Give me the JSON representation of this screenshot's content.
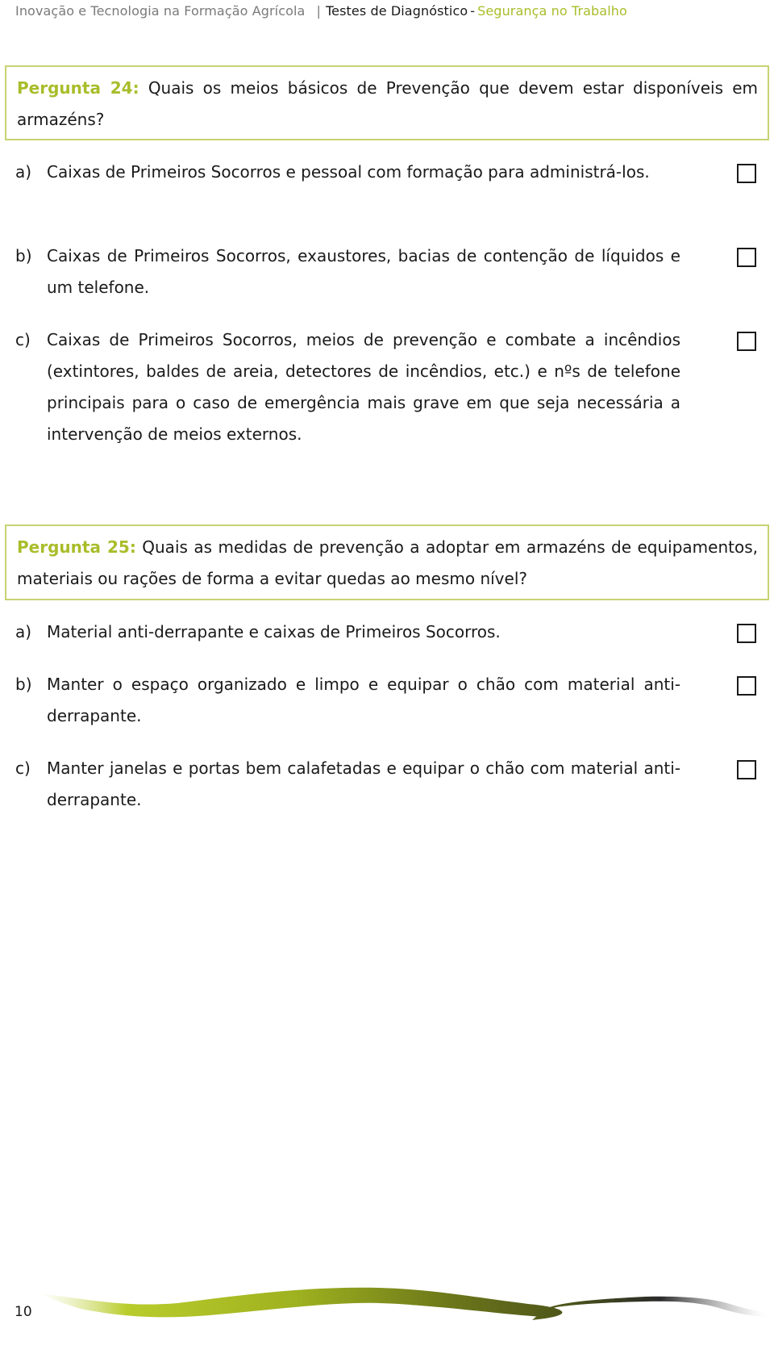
{
  "header": {
    "course": "Inovação e Tecnologia na Formação Agrícola",
    "separator": "|",
    "section": "Testes de Diagnóstico",
    "dash": "-",
    "topic": "Segurança no Trabalho"
  },
  "questions": [
    {
      "label": "Pergunta 24:",
      "text": "Quais os meios básicos de Prevenção que devem estar disponíveis em armazéns?",
      "options": [
        {
          "letter": "a)",
          "text": "Caixas de Primeiros Socorros e pessoal com formação para administrá-los.",
          "checked": false
        },
        {
          "letter": "b)",
          "text": "Caixas de Primeiros Socorros, exaustores, bacias de contenção de líquidos e um telefone.",
          "checked": false
        },
        {
          "letter": "c)",
          "text": "Caixas de Primeiros Socorros, meios de prevenção e combate a incêndios (extintores, baldes de areia, detectores de incêndios, etc.) e nºs de telefone principais para o caso de emergência mais grave em que seja necessária a intervenção de meios externos.",
          "checked": false
        }
      ]
    },
    {
      "label": "Pergunta 25:",
      "text": "Quais as medidas de prevenção a adoptar em armazéns de equipamentos, materiais ou rações de forma a evitar quedas ao mesmo nível?",
      "options": [
        {
          "letter": "a)",
          "text": "Material anti-derrapante e caixas de Primeiros Socorros.",
          "checked": false
        },
        {
          "letter": "b)",
          "text": "Manter o espaço organizado e limpo e equipar o chão com material anti-derrapante.",
          "checked": false
        },
        {
          "letter": "c)",
          "text": "Manter janelas e portas bem calafetadas e equipar o chão com material anti-derrapante.",
          "checked": false
        }
      ]
    }
  ],
  "footer": {
    "page_number": "10"
  },
  "colors": {
    "accent_green": "#a9bd2a",
    "box_border": "#c7d370",
    "text": "#1a1a1a",
    "muted": "#7a7a7a"
  }
}
